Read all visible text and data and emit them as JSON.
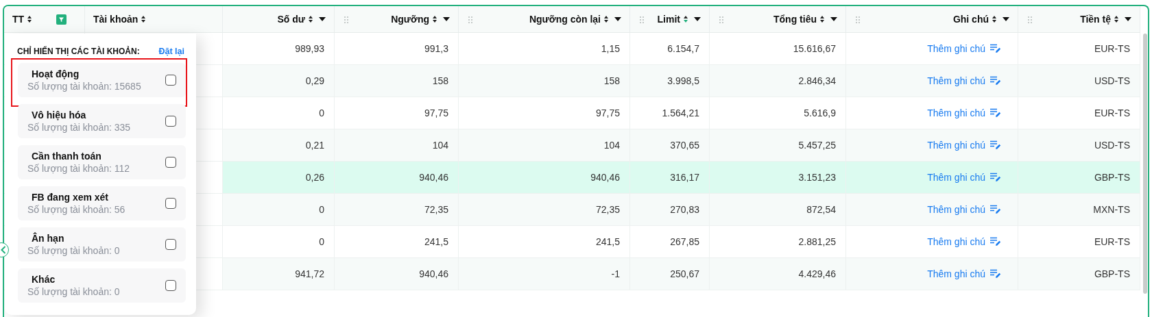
{
  "table": {
    "columns": [
      {
        "label": "TT",
        "sorted": false,
        "filter_active": true,
        "handle": false,
        "menu": false
      },
      {
        "label": "Tài khoản",
        "sorted": false,
        "handle": false,
        "menu": false
      },
      {
        "label": "Số dư",
        "sorted": false,
        "handle": false,
        "menu": true
      },
      {
        "label": "Ngưỡng",
        "sorted": false,
        "handle": true,
        "menu": true
      },
      {
        "label": "Ngưỡng còn lại",
        "sorted": false,
        "handle": true,
        "menu": true
      },
      {
        "label": "Limit",
        "sorted": true,
        "handle": true,
        "menu": true
      },
      {
        "label": "Tổng tiêu",
        "sorted": false,
        "handle": true,
        "menu": true
      },
      {
        "label": "Ghi chú",
        "sorted": false,
        "handle": true,
        "menu": true
      },
      {
        "label": "Tiền tệ",
        "sorted": false,
        "handle": true,
        "menu": true
      }
    ],
    "rows": [
      {
        "so_du": "989,93",
        "nguong": "991,3",
        "nguong_con_lai": "1,15",
        "limit": "6.154,7",
        "tong_tieu": "15.616,67",
        "ghi_chu": "Thêm ghi chú",
        "tien_te": "EUR-TS",
        "selected": false
      },
      {
        "so_du": "0,29",
        "nguong": "158",
        "nguong_con_lai": "158",
        "limit": "3.998,5",
        "tong_tieu": "2.846,34",
        "ghi_chu": "Thêm ghi chú",
        "tien_te": "USD-TS",
        "selected": false
      },
      {
        "so_du": "0",
        "nguong": "97,75",
        "nguong_con_lai": "97,75",
        "limit": "1.564,21",
        "tong_tieu": "5.616,9",
        "ghi_chu": "Thêm ghi chú",
        "tien_te": "EUR-TS",
        "selected": false
      },
      {
        "so_du": "0,21",
        "nguong": "104",
        "nguong_con_lai": "104",
        "limit": "370,65",
        "tong_tieu": "5.457,25",
        "ghi_chu": "Thêm ghi chú",
        "tien_te": "USD-TS",
        "selected": false
      },
      {
        "so_du": "0,26",
        "nguong": "940,46",
        "nguong_con_lai": "940,46",
        "limit": "316,17",
        "tong_tieu": "3.151,23",
        "ghi_chu": "Thêm ghi chú",
        "tien_te": "GBP-TS",
        "selected": true
      },
      {
        "so_du": "0",
        "nguong": "72,35",
        "nguong_con_lai": "72,35",
        "limit": "270,83",
        "tong_tieu": "872,54",
        "ghi_chu": "Thêm ghi chú",
        "tien_te": "MXN-TS",
        "selected": false
      },
      {
        "so_du": "0",
        "nguong": "241,5",
        "nguong_con_lai": "241,5",
        "limit": "267,85",
        "tong_tieu": "2.881,25",
        "ghi_chu": "Thêm ghi chú",
        "tien_te": "EUR-TS",
        "selected": false
      },
      {
        "so_du": "941,72",
        "nguong": "940,46",
        "nguong_con_lai": "-1",
        "limit": "250,67",
        "tong_tieu": "4.429,46",
        "ghi_chu": "Thêm ghi chú",
        "tien_te": "GBP-TS",
        "selected": false
      }
    ]
  },
  "filter_popover": {
    "title": "CHỈ HIỂN THỊ CÁC TÀI KHOẢN:",
    "reset_link": "Đặt lại",
    "options": [
      {
        "label": "Hoạt động",
        "count": "Số lượng tài khoản: 15685",
        "checked": false,
        "highlighted": true
      },
      {
        "label": "Vô hiệu hóa",
        "count": "Số lượng tài khoản: 335",
        "checked": false,
        "highlighted": false
      },
      {
        "label": "Cần thanh toán",
        "count": "Số lượng tài khoản: 112",
        "checked": false,
        "highlighted": false
      },
      {
        "label": "FB đang xem xét",
        "count": "Số lượng tài khoản: 56",
        "checked": false,
        "highlighted": false
      },
      {
        "label": "Ân hạn",
        "count": "Số lượng tài khoản: 0",
        "checked": false,
        "highlighted": false
      },
      {
        "label": "Khác",
        "count": "Số lượng tài khoản: 0",
        "checked": false,
        "highlighted": false
      }
    ]
  }
}
